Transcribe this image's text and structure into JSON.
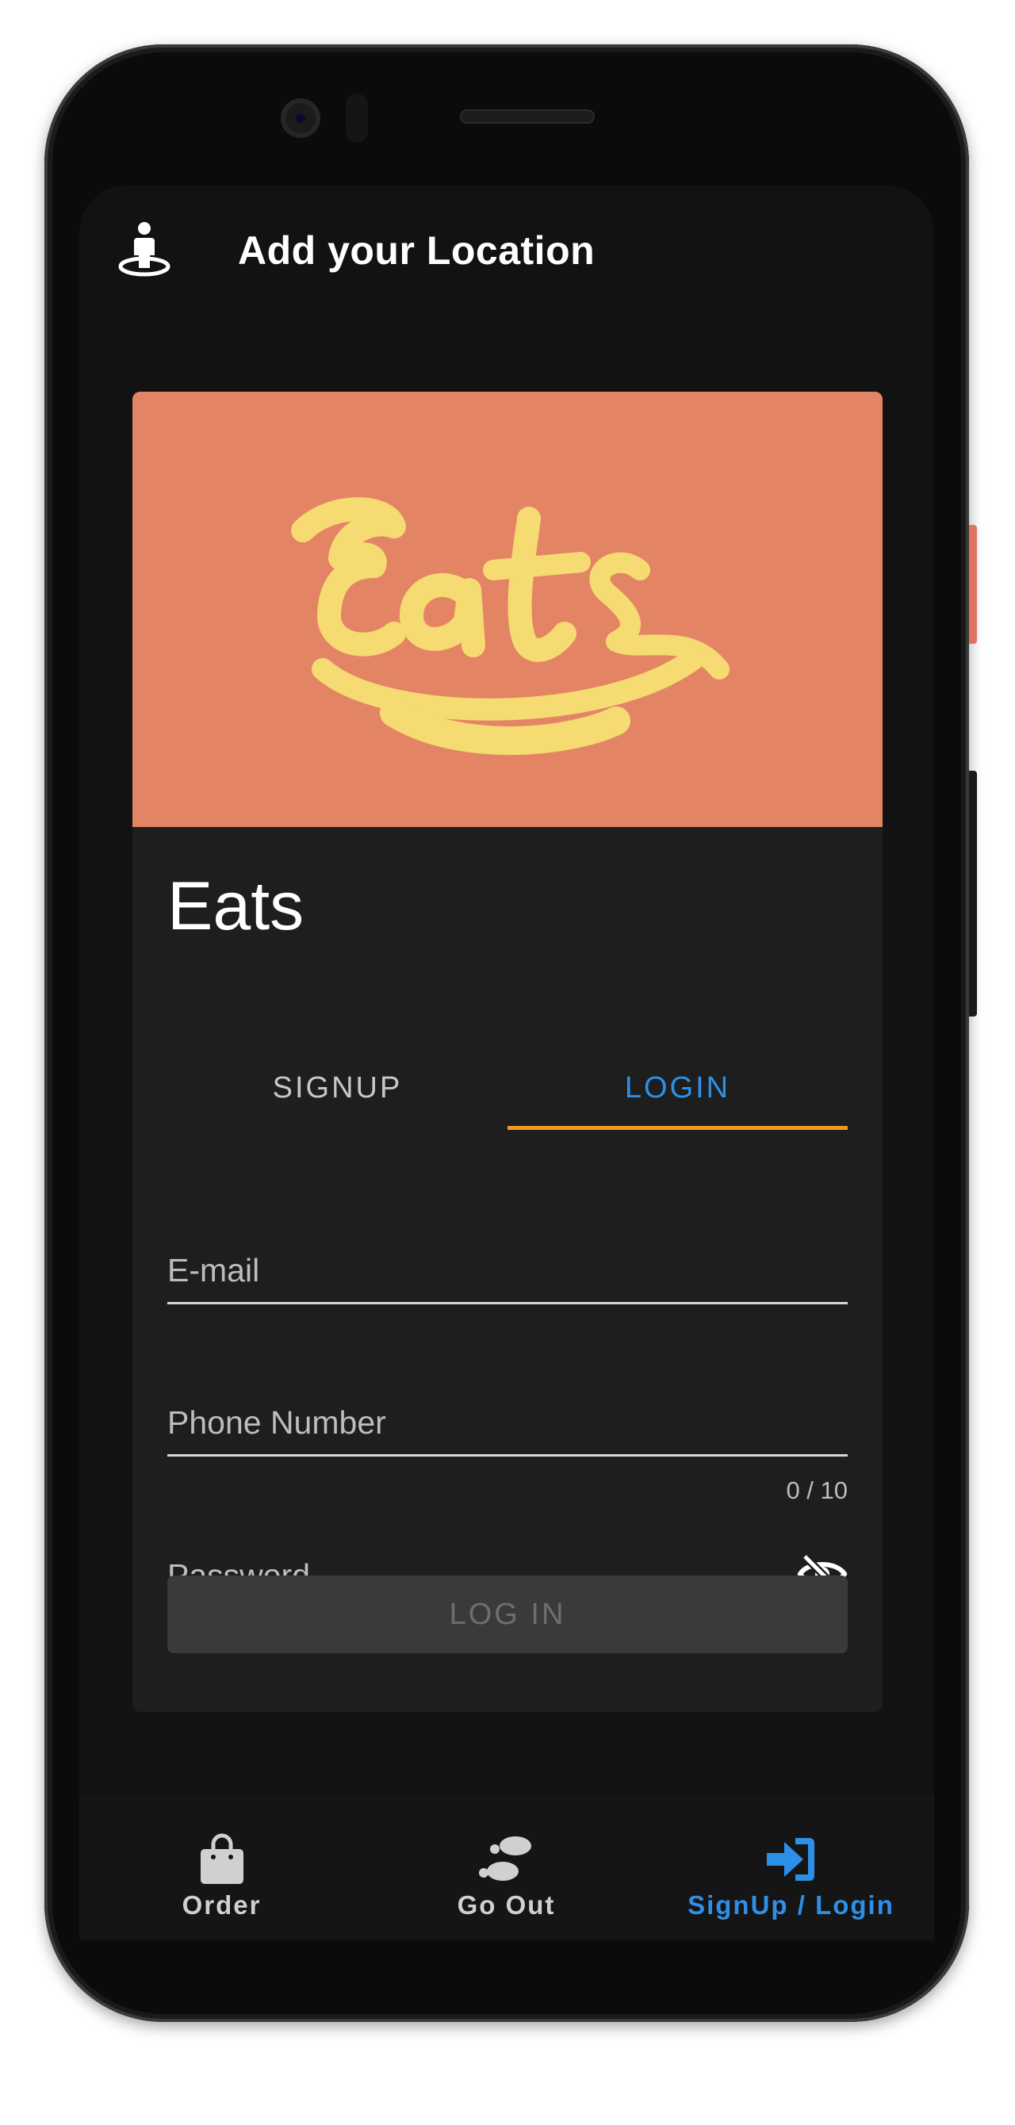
{
  "header": {
    "title": "Add your Location",
    "icon": "location-person-icon"
  },
  "banner": {
    "logo_text": "Eats",
    "background_color": "#e38565",
    "logo_color": "#f6da72"
  },
  "card": {
    "app_name": "Eats"
  },
  "tabs": [
    {
      "label": "SIGNUP",
      "active": false
    },
    {
      "label": "LOGIN",
      "active": true
    }
  ],
  "form": {
    "email": {
      "placeholder": "E-mail",
      "value": ""
    },
    "phone": {
      "placeholder": "Phone Number",
      "value": "",
      "counter": "0 / 10"
    },
    "password": {
      "placeholder": "Password",
      "value": "",
      "toggle_icon": "eye-off-icon"
    },
    "submit_label": "LOG IN"
  },
  "bottom_nav": [
    {
      "label": "Order",
      "icon": "shopping-bag-icon",
      "active": false
    },
    {
      "label": "Go Out",
      "icon": "footprints-icon",
      "active": false
    },
    {
      "label": "SignUp / Login",
      "icon": "sign-in-icon",
      "active": true
    }
  ],
  "colors": {
    "accent_blue": "#2d90e8",
    "tab_indicator": "#f39a1d",
    "background": "#121212",
    "card": "#1e1e1e"
  }
}
